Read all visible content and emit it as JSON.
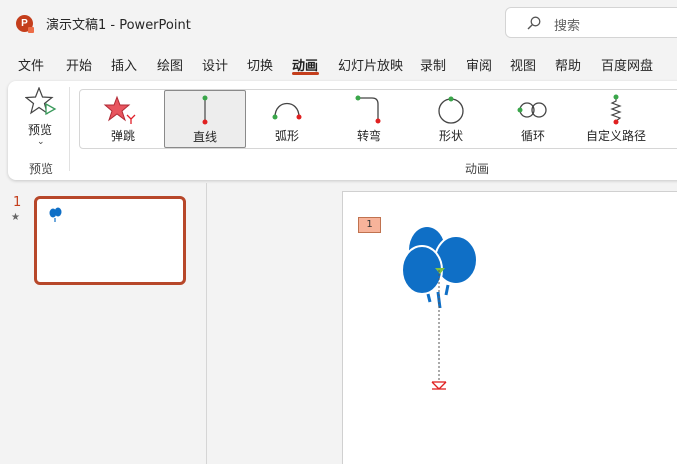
{
  "titlebar": {
    "app_icon_letter": "P",
    "title": "演示文稿1  -  PowerPoint",
    "search_placeholder": "搜索"
  },
  "menu": [
    {
      "label": "文件"
    },
    {
      "label": "开始"
    },
    {
      "label": "插入"
    },
    {
      "label": "绘图"
    },
    {
      "label": "设计"
    },
    {
      "label": "切换"
    },
    {
      "label": "动画",
      "active": true
    },
    {
      "label": "幻灯片放映"
    },
    {
      "label": "录制"
    },
    {
      "label": "审阅"
    },
    {
      "label": "视图"
    },
    {
      "label": "帮助"
    },
    {
      "label": "百度网盘"
    }
  ],
  "ribbon": {
    "preview_label": "预览",
    "preview_group_label": "预览",
    "animation_group_label": "动画",
    "animations": [
      {
        "label": "弹跳",
        "icon": "bounce-icon"
      },
      {
        "label": "直线",
        "icon": "line-path-icon",
        "selected": true
      },
      {
        "label": "弧形",
        "icon": "arc-path-icon"
      },
      {
        "label": "转弯",
        "icon": "turn-path-icon"
      },
      {
        "label": "形状",
        "icon": "shape-path-icon"
      },
      {
        "label": "循环",
        "icon": "loop-path-icon"
      },
      {
        "label": "自定义路径",
        "icon": "custom-path-icon"
      }
    ]
  },
  "thumbnails": {
    "slide_number": "1",
    "animation_marker": "★"
  },
  "slide": {
    "animation_tag": "1"
  },
  "colors": {
    "accent": "#c43e1c",
    "balloon": "#0f6fc6",
    "path_start": "#70ad47",
    "path_end": "#e02020"
  }
}
